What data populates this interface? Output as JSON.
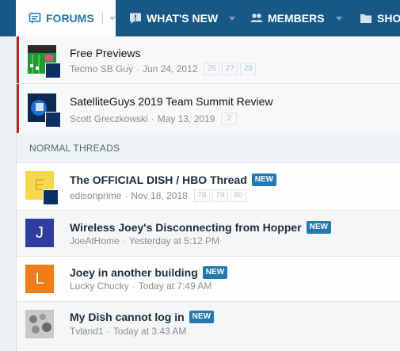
{
  "nav": {
    "tabs": [
      {
        "label": "FORUMS",
        "icon": "forum-icon",
        "active": true
      },
      {
        "label": "WHAT'S NEW",
        "icon": "comment-alert-icon",
        "active": false
      },
      {
        "label": "MEMBERS",
        "icon": "members-icon",
        "active": false
      },
      {
        "label": "SHO",
        "icon": "folder-icon",
        "active": false
      }
    ]
  },
  "colors": {
    "nav_bg": "#185886",
    "accent": "#2577b1",
    "sticky_bar": "#c61e1e"
  },
  "sticky_threads": [
    {
      "title": "Free Previews",
      "author": "Tecmo SB Guy",
      "date": "Jun 24, 2012",
      "pages": [
        "26",
        "27",
        "28"
      ]
    },
    {
      "title": "SatelliteGuys 2019 Team Summit Review",
      "author": "Scott Greczkowski",
      "date": "May 13, 2019",
      "pages": [
        "2"
      ]
    }
  ],
  "section": {
    "label": "NORMAL THREADS"
  },
  "threads": [
    {
      "title": "The OFFICIAL DISH / HBO Thread",
      "badge": "NEW",
      "author": "edisonprime",
      "date": "Nov 18, 2018",
      "pages": [
        "78",
        "79",
        "80"
      ],
      "avatar_letter": "E",
      "avatar_color": "#f5d94a"
    },
    {
      "title": "Wireless Joey's Disconnecting from Hopper",
      "badge": "NEW",
      "author": "JoeAtHome",
      "date": "Yesterday at 5:12 PM",
      "avatar_letter": "J",
      "avatar_color": "#2f3d9e"
    },
    {
      "title": "Joey in another building",
      "badge": "NEW",
      "author": "Lucky Chucky",
      "date": "Today at 7:49 AM",
      "avatar_letter": "L",
      "avatar_color": "#f07d1a"
    },
    {
      "title": "My Dish cannot log in",
      "badge": "NEW",
      "author": "Tvland1",
      "date": "Today at 3:43 AM"
    }
  ]
}
